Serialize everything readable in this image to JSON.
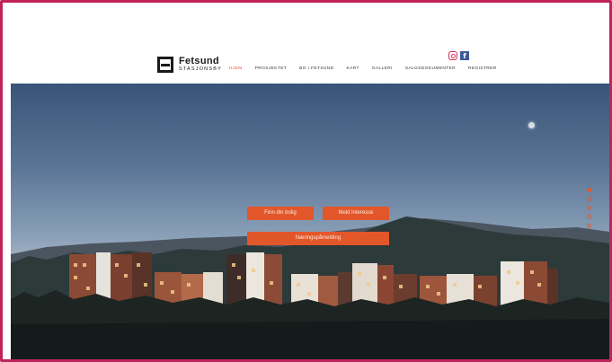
{
  "brand": {
    "name": "Fetsund",
    "subtitle": "STASJONSBY"
  },
  "nav": {
    "items": [
      {
        "label": "HJEM",
        "active": true
      },
      {
        "label": "PROSJEKTET",
        "active": false
      },
      {
        "label": "BO I FETSUND",
        "active": false
      },
      {
        "label": "KART",
        "active": false
      },
      {
        "label": "GALLERI",
        "active": false
      },
      {
        "label": "SALGSDOKUMENTER",
        "active": false
      },
      {
        "label": "REGISTRER",
        "active": false
      }
    ]
  },
  "social": {
    "instagram_icon": "instagram-icon",
    "facebook_glyph": "f"
  },
  "hero": {
    "buttons": {
      "find_home": "Finn din bolig",
      "register_interest": "Meld interesse",
      "business_signup": "Næringspåmelding"
    },
    "slides": {
      "count": 5,
      "active_index": 0
    }
  },
  "colors": {
    "accent": "#e2572a",
    "frame": "#c0245a",
    "facebook": "#3b5b9a"
  }
}
